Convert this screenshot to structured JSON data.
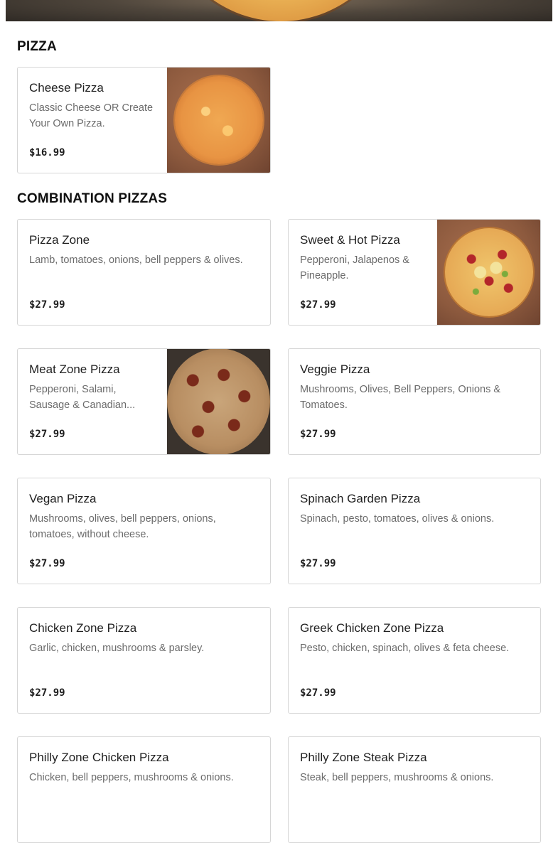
{
  "sections": [
    {
      "title": "PIZZA",
      "items": [
        {
          "name": "Cheese Pizza",
          "description": "Classic Cheese OR Create Your Own Pizza.",
          "price": "$16.99",
          "image": "cheese-pizza-photo"
        }
      ]
    },
    {
      "title": "COMBINATION PIZZAS",
      "items": [
        {
          "name": "Pizza Zone",
          "description": "Lamb, tomatoes, onions, bell peppers & olives.",
          "price": "$27.99"
        },
        {
          "name": "Sweet & Hot Pizza",
          "description": "Pepperoni, Jalapenos & Pineapple.",
          "price": "$27.99",
          "image": "sweet-hot-pizza-photo"
        },
        {
          "name": "Meat Zone Pizza",
          "description": "Pepperoni, Salami, Sausage & Canadian...",
          "price": "$27.99",
          "image": "meat-zone-pizza-photo"
        },
        {
          "name": "Veggie Pizza",
          "description": "Mushrooms, Olives, Bell Peppers, Onions & Tomatoes.",
          "price": "$27.99"
        },
        {
          "name": "Vegan Pizza",
          "description": "Mushrooms, olives, bell peppers, onions, tomatoes, without cheese.",
          "price": "$27.99"
        },
        {
          "name": "Spinach Garden Pizza",
          "description": "Spinach, pesto, tomatoes, olives & onions.",
          "price": "$27.99"
        },
        {
          "name": "Chicken Zone Pizza",
          "description": "Garlic, chicken, mushrooms & parsley.",
          "price": "$27.99"
        },
        {
          "name": "Greek Chicken Zone Pizza",
          "description": "Pesto, chicken, spinach, olives & feta cheese.",
          "price": "$27.99"
        },
        {
          "name": "Philly Zone Chicken Pizza",
          "description": "Chicken, bell peppers, mushrooms & onions.",
          "price": ""
        },
        {
          "name": "Philly Zone Steak Pizza",
          "description": "Steak, bell peppers, mushrooms & onions.",
          "price": ""
        }
      ]
    }
  ],
  "colors": {
    "text": "#1f1f1f",
    "muted": "#6b6b6b",
    "border": "#d6d6d6"
  }
}
